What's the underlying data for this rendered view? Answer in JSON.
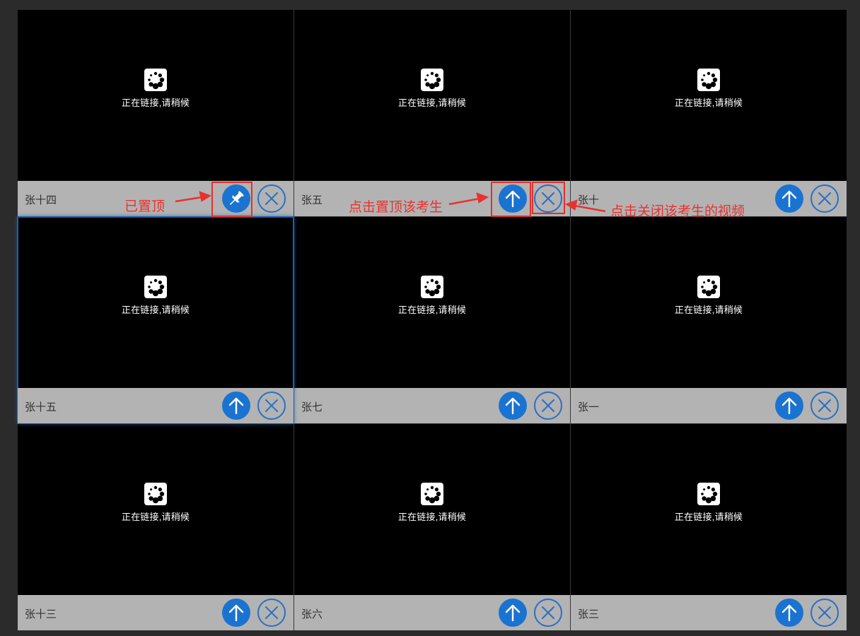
{
  "tiles": [
    {
      "name": "张十四",
      "status": "正在链接,请稍候",
      "pinned": true
    },
    {
      "name": "张五",
      "status": "正在链接,请稍候",
      "pinned": false
    },
    {
      "name": "张十",
      "status": "正在链接,请稍候",
      "pinned": false
    },
    {
      "name": "张十五",
      "status": "正在链接,请稍候",
      "pinned": false,
      "selected": true
    },
    {
      "name": "张七",
      "status": "正在链接,请稍候",
      "pinned": false
    },
    {
      "name": "张一",
      "status": "正在链接,请稍候",
      "pinned": false
    },
    {
      "name": "张十三",
      "status": "正在链接,请稍候",
      "pinned": false
    },
    {
      "name": "张六",
      "status": "正在链接,请稍候",
      "pinned": false
    },
    {
      "name": "张三",
      "status": "正在链接,请稍候",
      "pinned": false
    }
  ],
  "annotations": {
    "pinned": "已置顶",
    "pin_hint": "点击置顶该考生",
    "close_hint": "点击关闭该考生的视频"
  },
  "colors": {
    "button_blue": "#1a73d1",
    "annotation_red": "#e8322f",
    "bar_gray": "#b3b3b3"
  },
  "icons": {
    "loading": "loading-spinner-icon",
    "pin_top": "arrow-up-icon",
    "pinned": "pushpin-icon",
    "close": "close-x-icon"
  }
}
